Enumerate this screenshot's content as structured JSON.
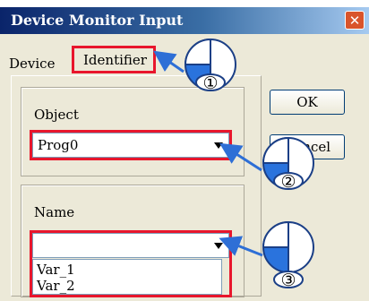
{
  "window": {
    "title": "Device Monitor Input",
    "close_glyph": "✕"
  },
  "tabs": [
    {
      "label": "Device"
    },
    {
      "label": "Identifier"
    }
  ],
  "object": {
    "label": "Object",
    "value": "Prog0"
  },
  "name": {
    "label": "Name",
    "value": "",
    "options": [
      "Var_1",
      "Var_2"
    ]
  },
  "buttons": {
    "ok": "OK",
    "cancel": "Cancel"
  },
  "callouts": [
    {
      "number": "①"
    },
    {
      "number": "②"
    },
    {
      "number": "③"
    }
  ],
  "colors": {
    "highlight": "#e8162c",
    "arrow": "#2e6fd6",
    "bubble_fill": "#2a73dd"
  }
}
